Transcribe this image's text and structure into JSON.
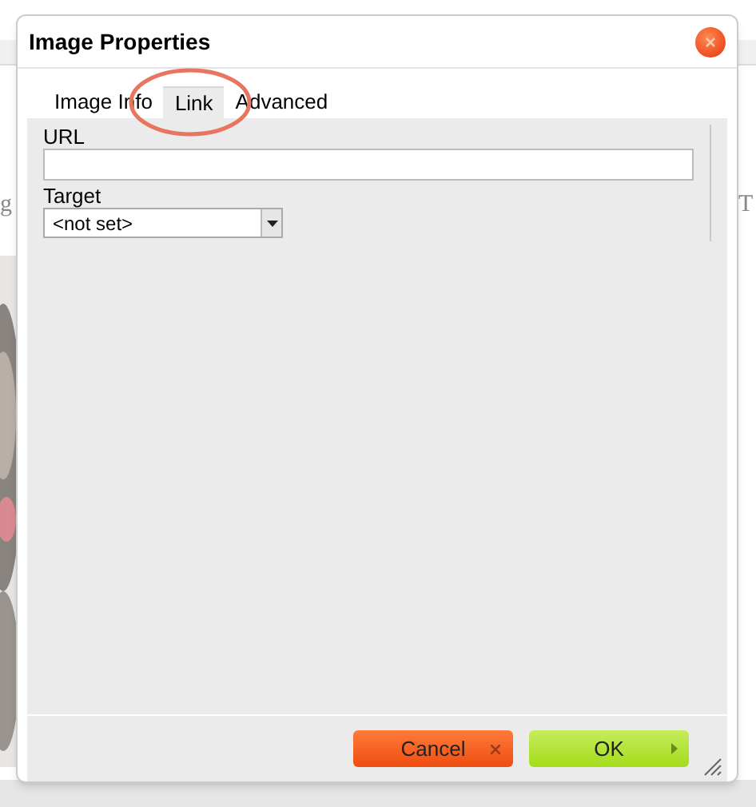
{
  "page": {
    "left_text": "g",
    "right_text": "T"
  },
  "dialog": {
    "title": "Image Properties",
    "tabs": [
      {
        "label": "Image Info",
        "selected": false
      },
      {
        "label": "Link",
        "selected": true
      },
      {
        "label": "Advanced",
        "selected": false
      }
    ],
    "url_label": "URL",
    "target_label": "Target",
    "target_value": "<not set>",
    "buttons": [
      {
        "label": "Cancel",
        "kind": "cancel"
      },
      {
        "label": "OK",
        "kind": "ok"
      }
    ]
  }
}
